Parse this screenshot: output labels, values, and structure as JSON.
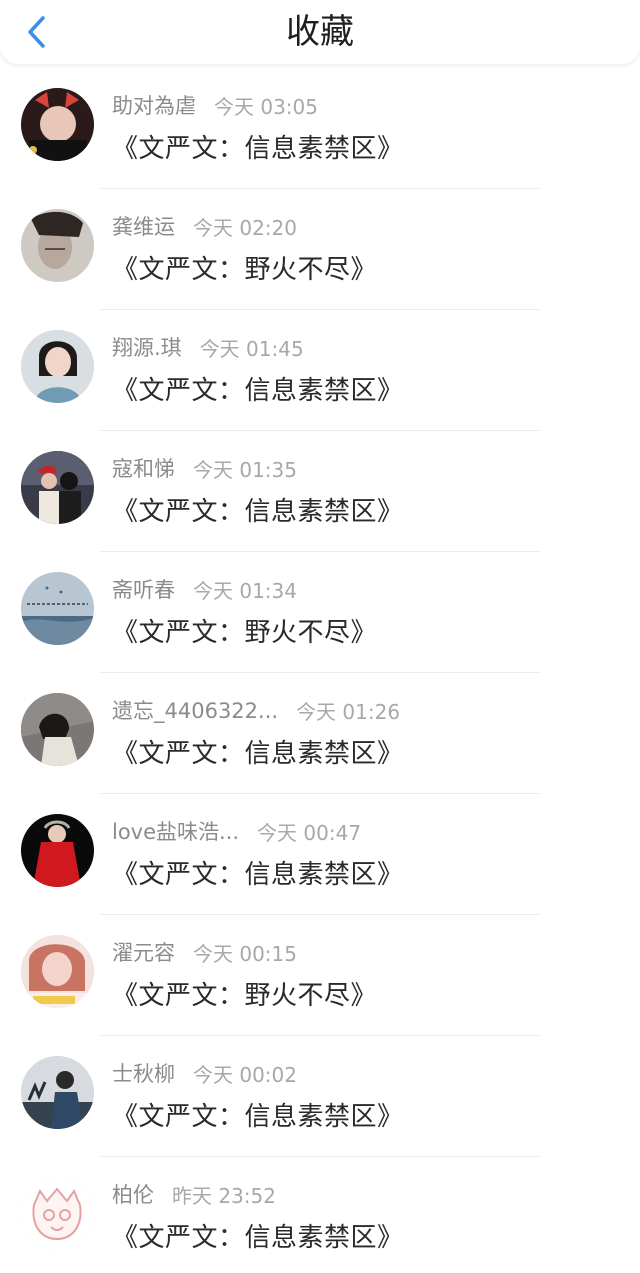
{
  "header": {
    "title": "收藏",
    "back_icon": "chevron-left-icon",
    "accent": "#3b8fe8"
  },
  "items": [
    {
      "name": "助对為虐",
      "time": "今天 03:05",
      "content": "《文严文：信息素禁区》",
      "avatar": "avatar-photo"
    },
    {
      "name": "龚维运",
      "time": "今天 02:20",
      "content": "《文严文：野火不尽》",
      "avatar": "avatar-photo"
    },
    {
      "name": "翔源.琪",
      "time": "今天 01:45",
      "content": "《文严文：信息素禁区》",
      "avatar": "avatar-photo"
    },
    {
      "name": "寇和悌",
      "time": "今天 01:35",
      "content": "《文严文：信息素禁区》",
      "avatar": "avatar-photo"
    },
    {
      "name": "斋听春",
      "time": "今天 01:34",
      "content": "《文严文：野火不尽》",
      "avatar": "avatar-photo"
    },
    {
      "name": "遗忘_4406322...",
      "time": "今天 01:26",
      "content": "《文严文：信息素禁区》",
      "avatar": "avatar-photo"
    },
    {
      "name": "love盐味浩...",
      "time": "今天 00:47",
      "content": "《文严文：信息素禁区》",
      "avatar": "avatar-photo"
    },
    {
      "name": "濯元容",
      "time": "今天 00:15",
      "content": "《文严文：野火不尽》",
      "avatar": "avatar-photo"
    },
    {
      "name": "士秋柳",
      "time": "今天 00:02",
      "content": "《文严文：信息素禁区》",
      "avatar": "avatar-photo"
    },
    {
      "name": "柏伦",
      "time": "昨天 23:52",
      "content": "《文严文：信息素禁区》",
      "avatar": "avatar-illustration"
    }
  ]
}
